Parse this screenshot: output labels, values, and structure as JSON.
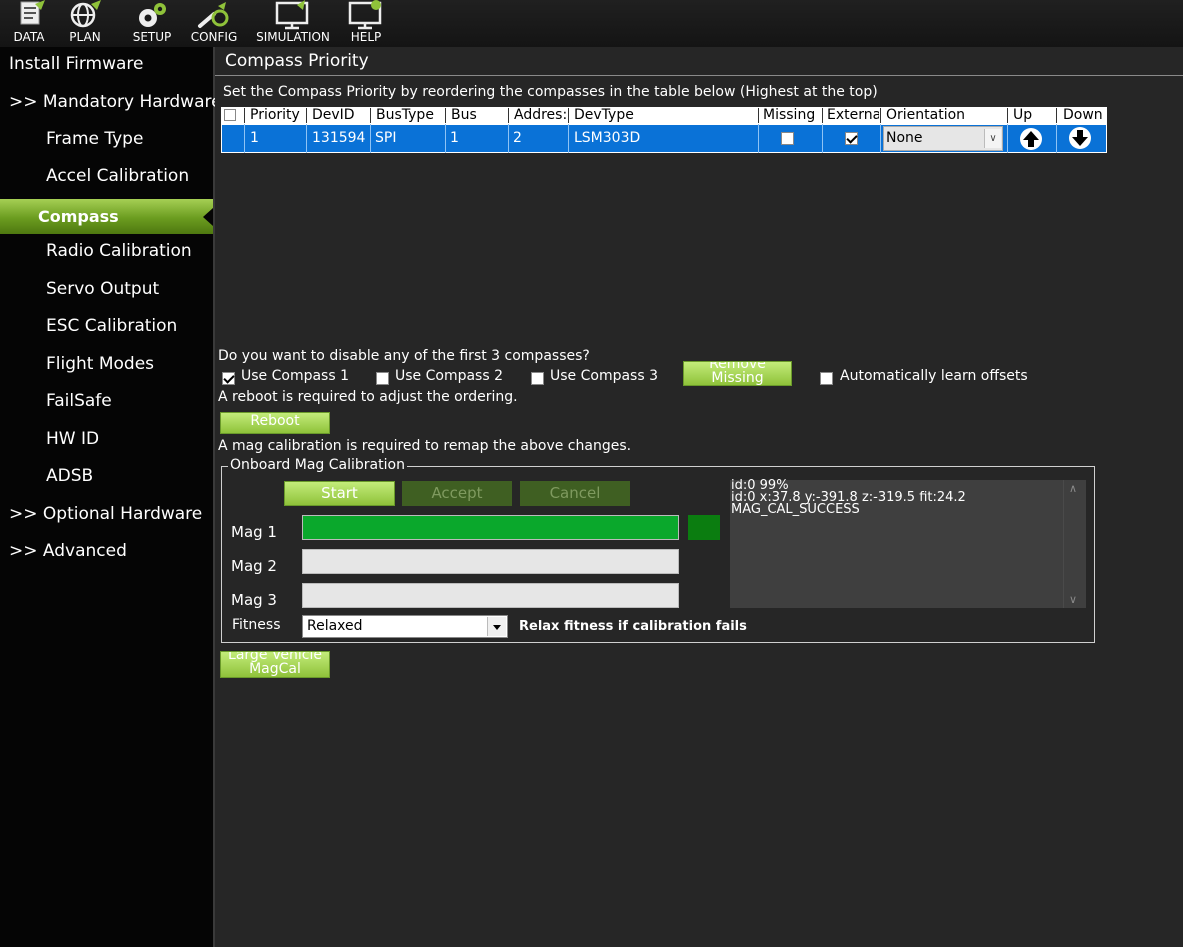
{
  "toolbar": {
    "items": [
      {
        "label": "DATA",
        "icon": "data-icon"
      },
      {
        "label": "PLAN",
        "icon": "globe-icon"
      },
      {
        "label": "SETUP",
        "icon": "gears-icon"
      },
      {
        "label": "CONFIG",
        "icon": "wrench-icon"
      },
      {
        "label": "SIMULATION",
        "icon": "monitor-icon"
      },
      {
        "label": "HELP",
        "icon": "help-monitor-icon"
      }
    ]
  },
  "sidebar": {
    "install_firmware": "Install Firmware",
    "mandatory_hardware": ">> Mandatory Hardware",
    "items": [
      "Frame Type",
      "Accel Calibration",
      "Compass",
      "Radio Calibration",
      "Servo Output",
      "ESC Calibration",
      "Flight Modes",
      "FailSafe",
      "HW ID",
      "ADSB"
    ],
    "optional_hardware": ">> Optional Hardware",
    "advanced": ">> Advanced",
    "active": "Compass"
  },
  "main": {
    "title": "Compass Priority",
    "instructions": "Set the Compass Priority by reordering the compasses in the table below (Highest at the top)",
    "table": {
      "headers": [
        "Priority",
        "DevID",
        "BusType",
        "Bus",
        "Address",
        "DevType",
        "Missing",
        "External",
        "Orientation",
        "Up",
        "Down"
      ],
      "header_display": [
        "Priority",
        "DevID",
        "BusType",
        "Bus",
        "Addres:",
        "DevType",
        "Missing",
        "Externa",
        "Orientation",
        "Up",
        "Down"
      ],
      "rows": [
        {
          "priority": "1",
          "devid": "131594",
          "bustype": "SPI",
          "bus": "1",
          "address": "2",
          "devtype": "LSM303D",
          "missing": false,
          "external": true,
          "orientation": "None"
        }
      ]
    },
    "disable_question": "Do you want to disable any of the first 3 compasses?",
    "use_compass_1": "Use Compass 1",
    "use_compass_2": "Use Compass 2",
    "use_compass_3": "Use Compass 3",
    "use_compass_1_checked": true,
    "use_compass_2_checked": false,
    "use_compass_3_checked": false,
    "remove_missing_line1": "Remove",
    "remove_missing_line2": "Missing",
    "auto_learn": "Automatically learn offsets",
    "auto_learn_checked": false,
    "reboot_note": "A reboot is required to adjust the ordering.",
    "reboot_button": "Reboot",
    "mag_note": "A mag calibration is required to remap the above changes.",
    "onboard_group": "Onboard Mag Calibration",
    "start": "Start",
    "accept": "Accept",
    "cancel": "Cancel",
    "mag1": "Mag 1",
    "mag2": "Mag 2",
    "mag3": "Mag 3",
    "mag1_progress": 1.0,
    "mag2_progress": 0,
    "mag3_progress": 0,
    "log_lines": [
      "id:0 99%",
      "id:0 x:37.8 y:-391.8 z:-319.5 fit:24.2",
      "MAG_CAL_SUCCESS"
    ],
    "fitness_label": "Fitness",
    "fitness_value": "Relaxed",
    "fitness_hint": "Relax fitness if calibration fails",
    "large_vehicle_line1": "Large Vehicle",
    "large_vehicle_line2": "MagCal"
  },
  "colors": {
    "accent_green": "#8fc23a",
    "row_selected": "#0a72d7",
    "progress_green": "#0aa82c",
    "status_square": "#0b7d10"
  }
}
